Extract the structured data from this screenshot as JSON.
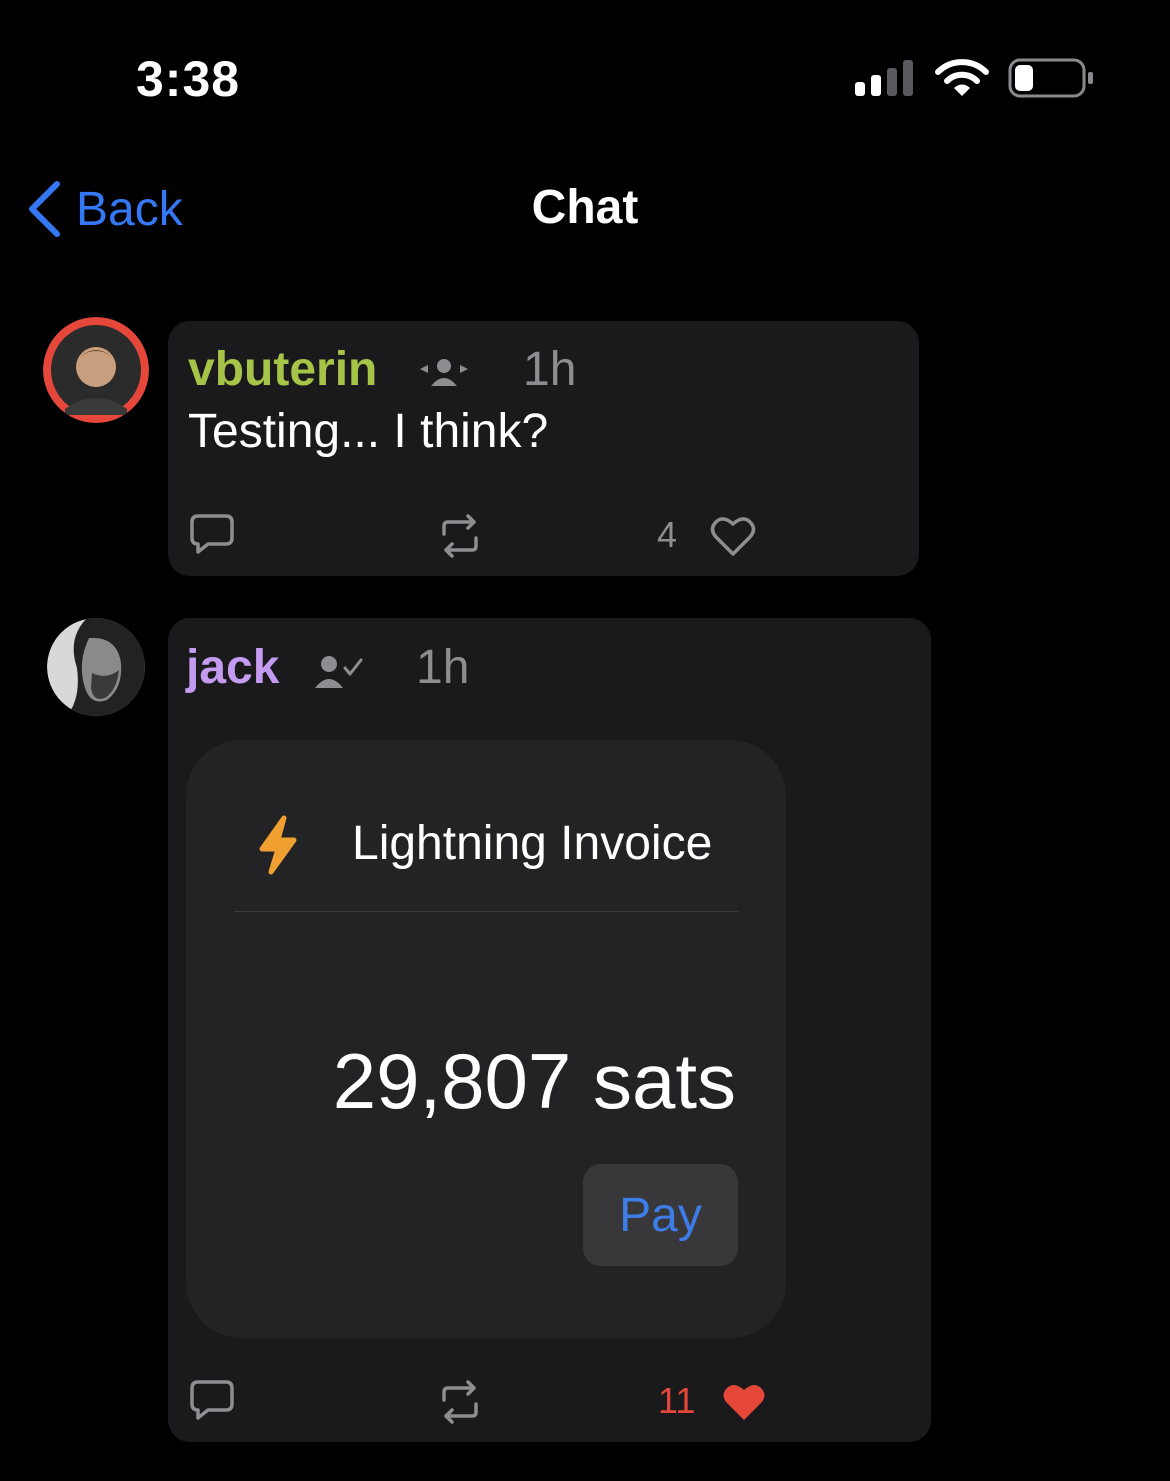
{
  "status_bar": {
    "time": "3:38"
  },
  "nav": {
    "back_label": "Back",
    "title": "Chat"
  },
  "messages": [
    {
      "username": "vbuterin",
      "username_color": "#a6c447",
      "timestamp": "1h",
      "text": "Testing... I think?",
      "like_count": "4",
      "liked": false,
      "badge_icon": "group-icon"
    },
    {
      "username": "jack",
      "username_color": "#c39bf0",
      "timestamp": "1h",
      "like_count": "11",
      "liked": true,
      "badge_icon": "user-check-icon",
      "invoice": {
        "title": "Lightning Invoice",
        "amount": "29,807 sats",
        "pay_label": "Pay"
      }
    }
  ],
  "colors": {
    "accent": "#3478f6",
    "like_active": "#e5483b",
    "bolt": "#f0a030"
  }
}
